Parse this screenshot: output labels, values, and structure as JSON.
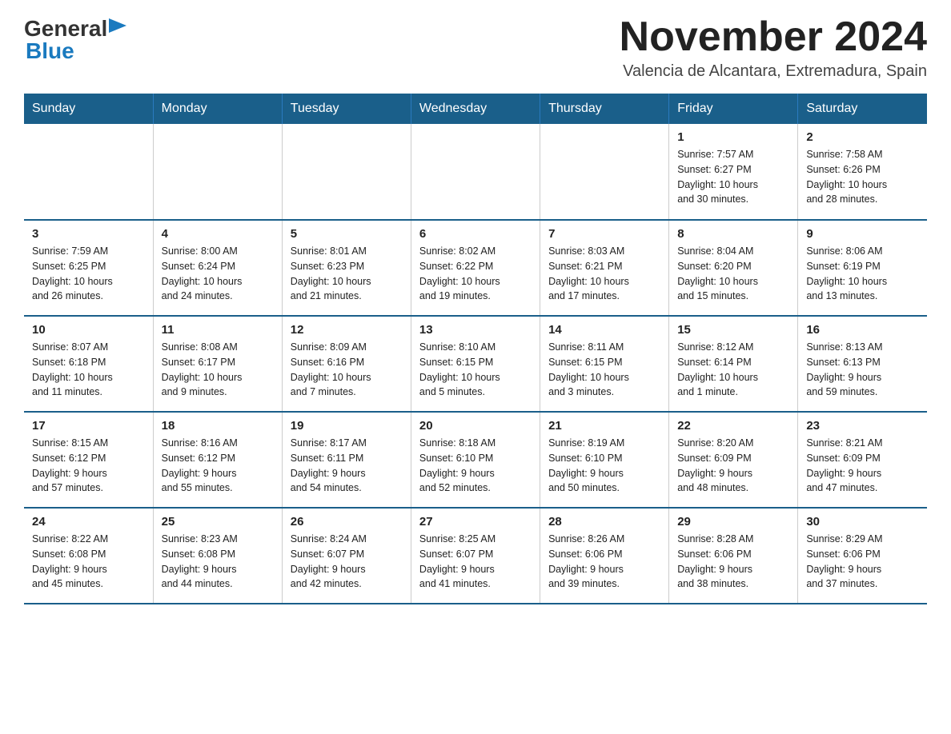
{
  "logo": {
    "general": "General",
    "blue": "Blue",
    "arrow": "▶"
  },
  "title": "November 2024",
  "location": "Valencia de Alcantara, Extremadura, Spain",
  "headers": [
    "Sunday",
    "Monday",
    "Tuesday",
    "Wednesday",
    "Thursday",
    "Friday",
    "Saturday"
  ],
  "weeks": [
    [
      {
        "day": "",
        "info": ""
      },
      {
        "day": "",
        "info": ""
      },
      {
        "day": "",
        "info": ""
      },
      {
        "day": "",
        "info": ""
      },
      {
        "day": "",
        "info": ""
      },
      {
        "day": "1",
        "info": "Sunrise: 7:57 AM\nSunset: 6:27 PM\nDaylight: 10 hours\nand 30 minutes."
      },
      {
        "day": "2",
        "info": "Sunrise: 7:58 AM\nSunset: 6:26 PM\nDaylight: 10 hours\nand 28 minutes."
      }
    ],
    [
      {
        "day": "3",
        "info": "Sunrise: 7:59 AM\nSunset: 6:25 PM\nDaylight: 10 hours\nand 26 minutes."
      },
      {
        "day": "4",
        "info": "Sunrise: 8:00 AM\nSunset: 6:24 PM\nDaylight: 10 hours\nand 24 minutes."
      },
      {
        "day": "5",
        "info": "Sunrise: 8:01 AM\nSunset: 6:23 PM\nDaylight: 10 hours\nand 21 minutes."
      },
      {
        "day": "6",
        "info": "Sunrise: 8:02 AM\nSunset: 6:22 PM\nDaylight: 10 hours\nand 19 minutes."
      },
      {
        "day": "7",
        "info": "Sunrise: 8:03 AM\nSunset: 6:21 PM\nDaylight: 10 hours\nand 17 minutes."
      },
      {
        "day": "8",
        "info": "Sunrise: 8:04 AM\nSunset: 6:20 PM\nDaylight: 10 hours\nand 15 minutes."
      },
      {
        "day": "9",
        "info": "Sunrise: 8:06 AM\nSunset: 6:19 PM\nDaylight: 10 hours\nand 13 minutes."
      }
    ],
    [
      {
        "day": "10",
        "info": "Sunrise: 8:07 AM\nSunset: 6:18 PM\nDaylight: 10 hours\nand 11 minutes."
      },
      {
        "day": "11",
        "info": "Sunrise: 8:08 AM\nSunset: 6:17 PM\nDaylight: 10 hours\nand 9 minutes."
      },
      {
        "day": "12",
        "info": "Sunrise: 8:09 AM\nSunset: 6:16 PM\nDaylight: 10 hours\nand 7 minutes."
      },
      {
        "day": "13",
        "info": "Sunrise: 8:10 AM\nSunset: 6:15 PM\nDaylight: 10 hours\nand 5 minutes."
      },
      {
        "day": "14",
        "info": "Sunrise: 8:11 AM\nSunset: 6:15 PM\nDaylight: 10 hours\nand 3 minutes."
      },
      {
        "day": "15",
        "info": "Sunrise: 8:12 AM\nSunset: 6:14 PM\nDaylight: 10 hours\nand 1 minute."
      },
      {
        "day": "16",
        "info": "Sunrise: 8:13 AM\nSunset: 6:13 PM\nDaylight: 9 hours\nand 59 minutes."
      }
    ],
    [
      {
        "day": "17",
        "info": "Sunrise: 8:15 AM\nSunset: 6:12 PM\nDaylight: 9 hours\nand 57 minutes."
      },
      {
        "day": "18",
        "info": "Sunrise: 8:16 AM\nSunset: 6:12 PM\nDaylight: 9 hours\nand 55 minutes."
      },
      {
        "day": "19",
        "info": "Sunrise: 8:17 AM\nSunset: 6:11 PM\nDaylight: 9 hours\nand 54 minutes."
      },
      {
        "day": "20",
        "info": "Sunrise: 8:18 AM\nSunset: 6:10 PM\nDaylight: 9 hours\nand 52 minutes."
      },
      {
        "day": "21",
        "info": "Sunrise: 8:19 AM\nSunset: 6:10 PM\nDaylight: 9 hours\nand 50 minutes."
      },
      {
        "day": "22",
        "info": "Sunrise: 8:20 AM\nSunset: 6:09 PM\nDaylight: 9 hours\nand 48 minutes."
      },
      {
        "day": "23",
        "info": "Sunrise: 8:21 AM\nSunset: 6:09 PM\nDaylight: 9 hours\nand 47 minutes."
      }
    ],
    [
      {
        "day": "24",
        "info": "Sunrise: 8:22 AM\nSunset: 6:08 PM\nDaylight: 9 hours\nand 45 minutes."
      },
      {
        "day": "25",
        "info": "Sunrise: 8:23 AM\nSunset: 6:08 PM\nDaylight: 9 hours\nand 44 minutes."
      },
      {
        "day": "26",
        "info": "Sunrise: 8:24 AM\nSunset: 6:07 PM\nDaylight: 9 hours\nand 42 minutes."
      },
      {
        "day": "27",
        "info": "Sunrise: 8:25 AM\nSunset: 6:07 PM\nDaylight: 9 hours\nand 41 minutes."
      },
      {
        "day": "28",
        "info": "Sunrise: 8:26 AM\nSunset: 6:06 PM\nDaylight: 9 hours\nand 39 minutes."
      },
      {
        "day": "29",
        "info": "Sunrise: 8:28 AM\nSunset: 6:06 PM\nDaylight: 9 hours\nand 38 minutes."
      },
      {
        "day": "30",
        "info": "Sunrise: 8:29 AM\nSunset: 6:06 PM\nDaylight: 9 hours\nand 37 minutes."
      }
    ]
  ]
}
